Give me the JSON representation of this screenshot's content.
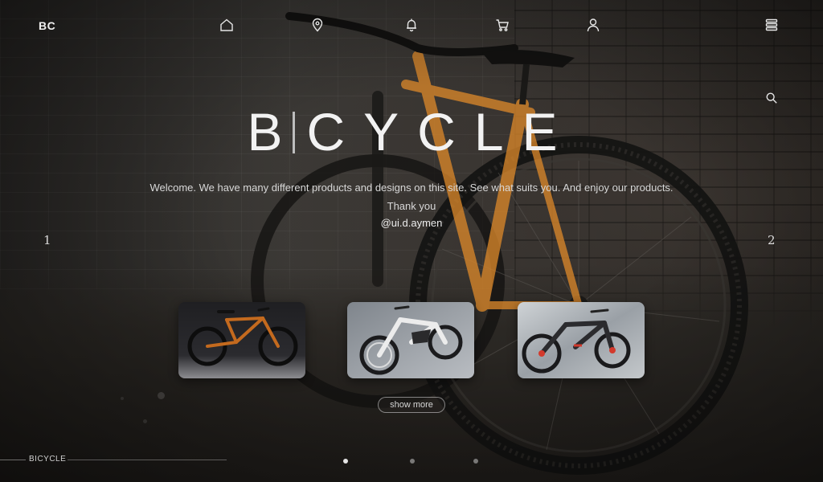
{
  "brand": {
    "logo": "BC"
  },
  "nav": {
    "items": [
      {
        "name": "home",
        "icon": "home-icon"
      },
      {
        "name": "location",
        "icon": "location-pin-icon"
      },
      {
        "name": "notifications",
        "icon": "bell-icon"
      },
      {
        "name": "cart",
        "icon": "cart-icon"
      },
      {
        "name": "profile",
        "icon": "user-icon"
      },
      {
        "name": "menu",
        "icon": "stacked-menu-icon"
      }
    ],
    "search_icon": "search-icon"
  },
  "hero": {
    "title_first": "B",
    "title_rest": "CYCLE",
    "description": "Welcome. We have many different products and designs on this site. See what suits you. And enjoy our products.",
    "thanks": "Thank you",
    "handle": "@ui.d.aymen"
  },
  "slides": {
    "prev": "1",
    "next": "2"
  },
  "products": [
    {
      "name": "orange-mountain-bike",
      "color": "#c46a1e"
    },
    {
      "name": "white-e-bike",
      "color": "#e8e8e8"
    },
    {
      "name": "red-accent-e-bike",
      "color": "#d33a2c"
    }
  ],
  "show_more_label": "show more",
  "footer": {
    "label": "BICYCLE"
  },
  "pagination": {
    "count": 3,
    "active_index": 0
  },
  "colors": {
    "accent": "#f2f2f2",
    "bike_frame": "#d8862a",
    "background": "#2a2826"
  }
}
